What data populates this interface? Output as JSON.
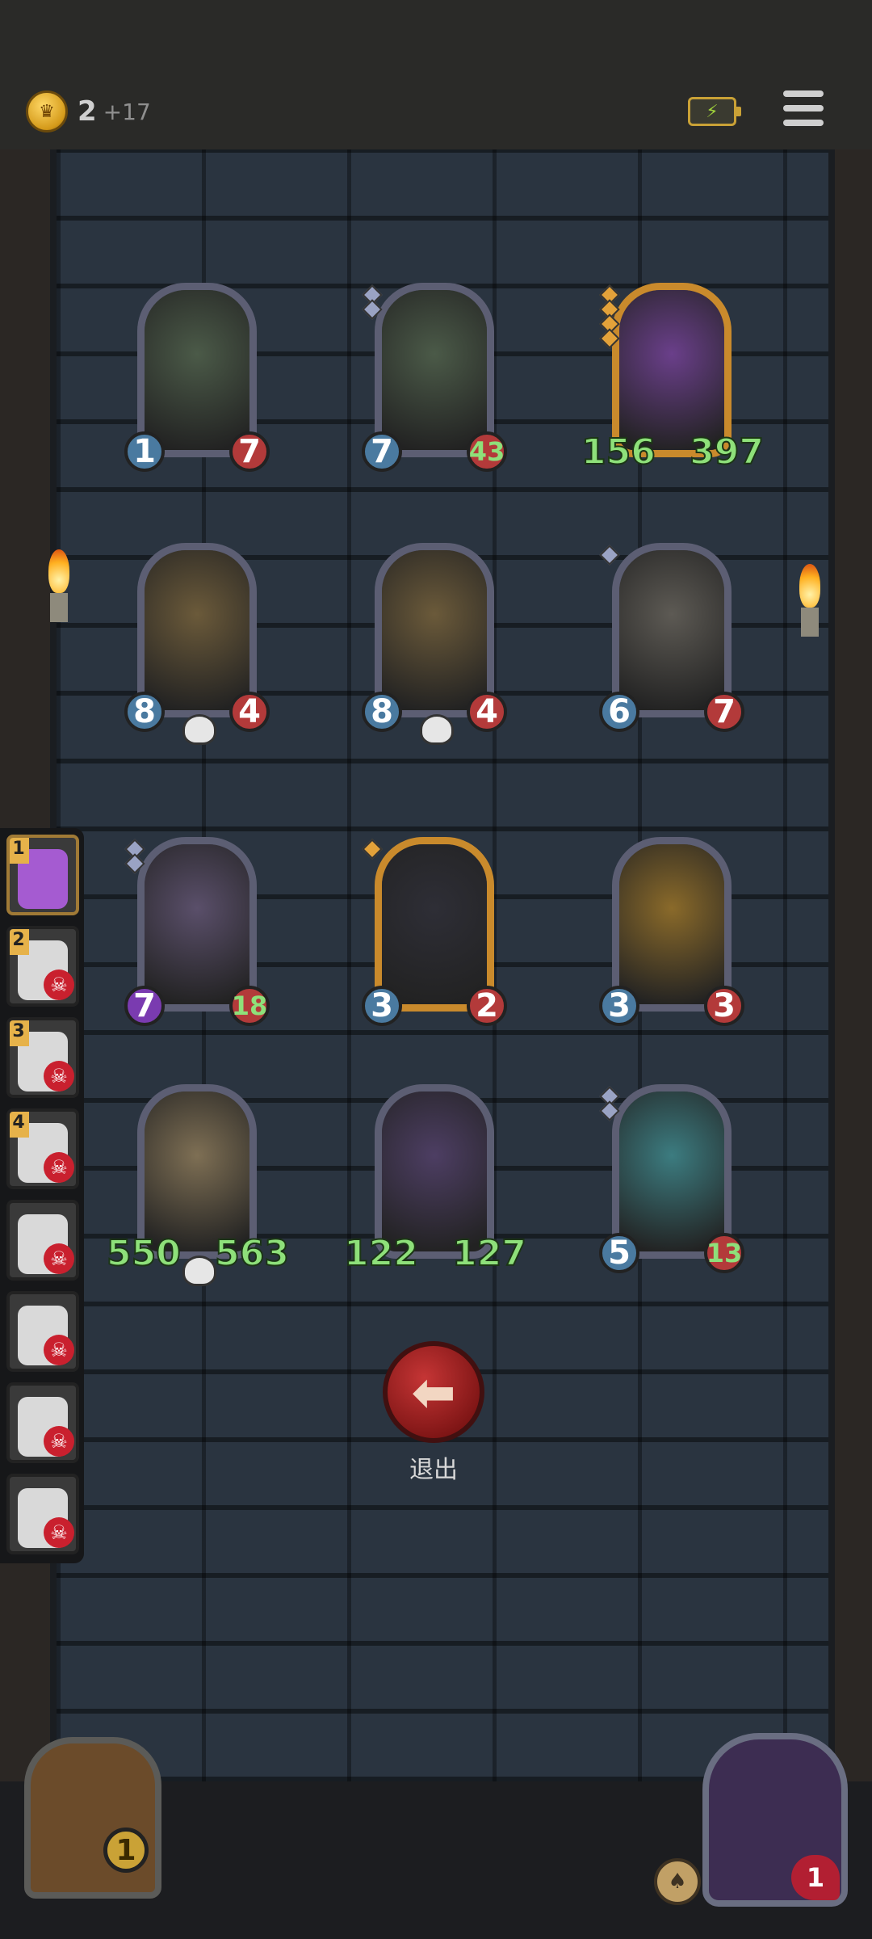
{
  "header": {
    "gold": "2",
    "gold_income": "+17",
    "coin_icon": "crown-coin-icon",
    "battery_icon": "battery-charging-icon",
    "menu_icon": "hamburger-menu-icon"
  },
  "board": {
    "cards": [
      {
        "name": "skeleton-guard",
        "attack": "1",
        "health": "7",
        "frame": "silver",
        "gems": 0,
        "skull": false
      },
      {
        "name": "skeleton-guard",
        "attack": "7",
        "health": "43",
        "frame": "silver",
        "gems": 2,
        "skull": false
      },
      {
        "name": "ghost-captain",
        "attack": "156",
        "health": "397",
        "frame": "gold",
        "gems": 4,
        "skull": false
      },
      {
        "name": "clockwork-beast",
        "attack": "8",
        "health": "4",
        "frame": "silver",
        "gems": 0,
        "skull": true
      },
      {
        "name": "clockwork-beast",
        "attack": "8",
        "health": "4",
        "frame": "silver",
        "gems": 0,
        "skull": true
      },
      {
        "name": "airship-bomber",
        "attack": "6",
        "health": "7",
        "frame": "silver",
        "gems": 1,
        "skull": false
      },
      {
        "name": "shadow-dragon",
        "attack": "7",
        "health": "18",
        "frame": "silver",
        "gems": 2,
        "skull": false
      },
      {
        "name": "hooded-necromancer",
        "attack": "3",
        "health": "2",
        "frame": "gold",
        "gems": 1,
        "skull": false
      },
      {
        "name": "flame-demon",
        "attack": "3",
        "health": "3",
        "frame": "silver",
        "gems": 0,
        "skull": false
      },
      {
        "name": "bone-dragon",
        "attack": "550",
        "health": "563",
        "frame": "silver",
        "gems": 0,
        "skull": true
      },
      {
        "name": "venom-dragon",
        "attack": "122",
        "health": "127",
        "frame": "silver",
        "gems": 0,
        "skull": false
      },
      {
        "name": "spectral-wizard",
        "attack": "5",
        "health": "13",
        "frame": "silver",
        "gems": 2,
        "skull": false
      }
    ]
  },
  "ranking": {
    "slots": [
      {
        "rank": "1",
        "active": true,
        "dead": false
      },
      {
        "rank": "2",
        "active": false,
        "dead": true
      },
      {
        "rank": "3",
        "active": false,
        "dead": true
      },
      {
        "rank": "4",
        "active": false,
        "dead": true
      },
      {
        "rank": "",
        "active": false,
        "dead": true
      },
      {
        "rank": "",
        "active": false,
        "dead": true
      },
      {
        "rank": "",
        "active": false,
        "dead": true
      },
      {
        "rank": "",
        "active": false,
        "dead": true
      }
    ]
  },
  "exit": {
    "label": "退出",
    "icon": "arrow-left-icon"
  },
  "footer": {
    "chest_count": "1",
    "hero_health": "1",
    "hero_icon": "purple-demon-portrait",
    "token_icon": "acorn-token-icon"
  }
}
